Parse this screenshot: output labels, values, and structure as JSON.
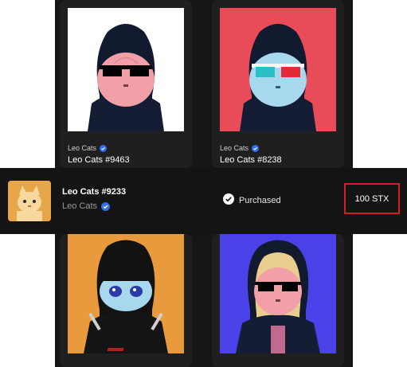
{
  "cards_top": [
    {
      "collection": "Leo Cats",
      "name": "Leo Cats #9463",
      "bg": "#ffffff"
    },
    {
      "collection": "Leo Cats",
      "name": "Leo Cats #8238",
      "bg": "#e84c58"
    }
  ],
  "cards_bottom": [
    {
      "bg": "#e89a3c"
    },
    {
      "bg": "#4a42e8"
    }
  ],
  "purchase_bar": {
    "name": "Leo Cats #9233",
    "collection": "Leo Cats",
    "status": "Purchased",
    "price": "100 STX"
  },
  "colors": {
    "verified_blue": "#2f6fe8",
    "highlight_red": "#d21f1f",
    "background": "#161616"
  }
}
